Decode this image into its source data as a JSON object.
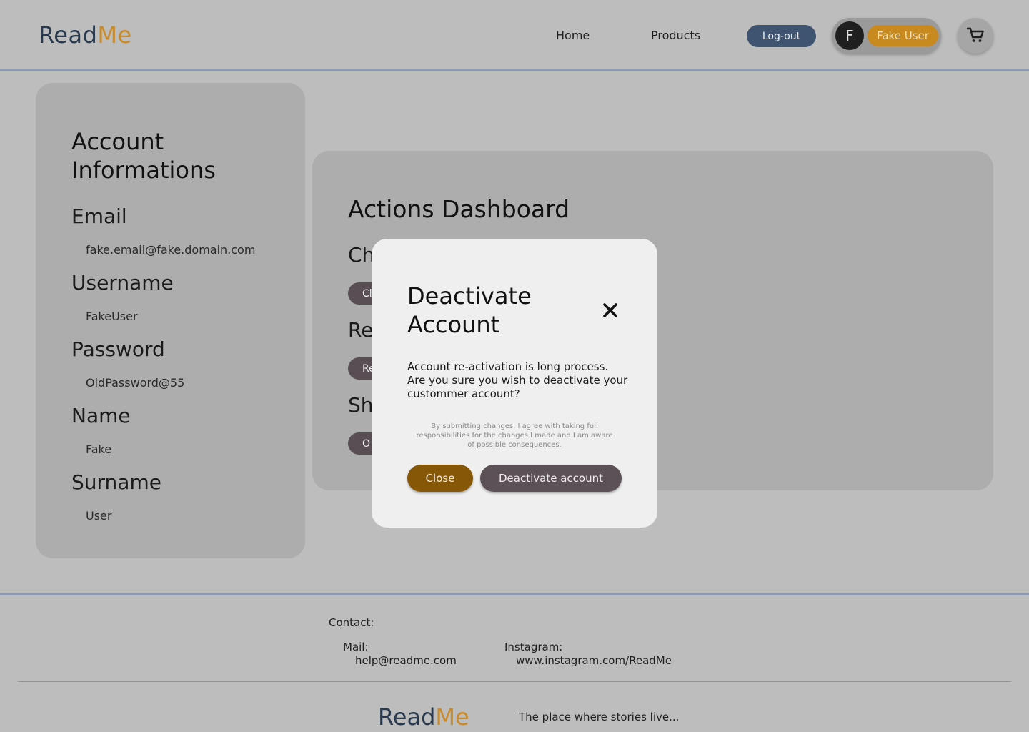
{
  "header": {
    "logo": {
      "part1": "Read",
      "part2": "Me"
    },
    "nav": {
      "home": "Home",
      "products": "Products"
    },
    "logout_label": "Log-out",
    "user": {
      "initial": "F",
      "name": "Fake User"
    },
    "cart_icon": "cart-icon"
  },
  "account": {
    "title": "Account Informations",
    "fields": [
      {
        "label": "Email",
        "value": "fake.email@fake.domain.com"
      },
      {
        "label": "Username",
        "value": "FakeUser"
      },
      {
        "label": "Password",
        "value": "OldPassword@55"
      },
      {
        "label": "Name",
        "value": "Fake"
      },
      {
        "label": "Surname",
        "value": "User"
      }
    ]
  },
  "actions": {
    "title": "Actions Dashboard",
    "items": [
      {
        "heading": "Ch",
        "button": "Cl"
      },
      {
        "heading": "Re",
        "button": "Re"
      },
      {
        "heading": "Sh",
        "button": "O"
      }
    ]
  },
  "modal": {
    "title": "Deactivate Account",
    "close_icon": "close-icon",
    "message": "Account re-activation is long process. Are you sure you wish to deactivate your custommer account?",
    "disclaimer": "By submitting changes, I agree with taking full responsibilities for the changes I made and I am aware of possible consequences.",
    "close_label": "Close",
    "deactivate_label": "Deactivate account"
  },
  "footer": {
    "contact_label": "Contact:",
    "mail_label": "Mail:",
    "mail_value": "help@readme.com",
    "instagram_label": "Instagram:",
    "instagram_value": "www.instagram.com/ReadMe",
    "logo": {
      "part1": "Read",
      "part2": "Me"
    },
    "tagline": "The place where stories live..."
  },
  "colors": {
    "background": "#bdbdbd",
    "accent": "#c98a2a",
    "navy": "#3e5470",
    "modal_close_button": "#875708",
    "action_button": "#5d5158"
  }
}
